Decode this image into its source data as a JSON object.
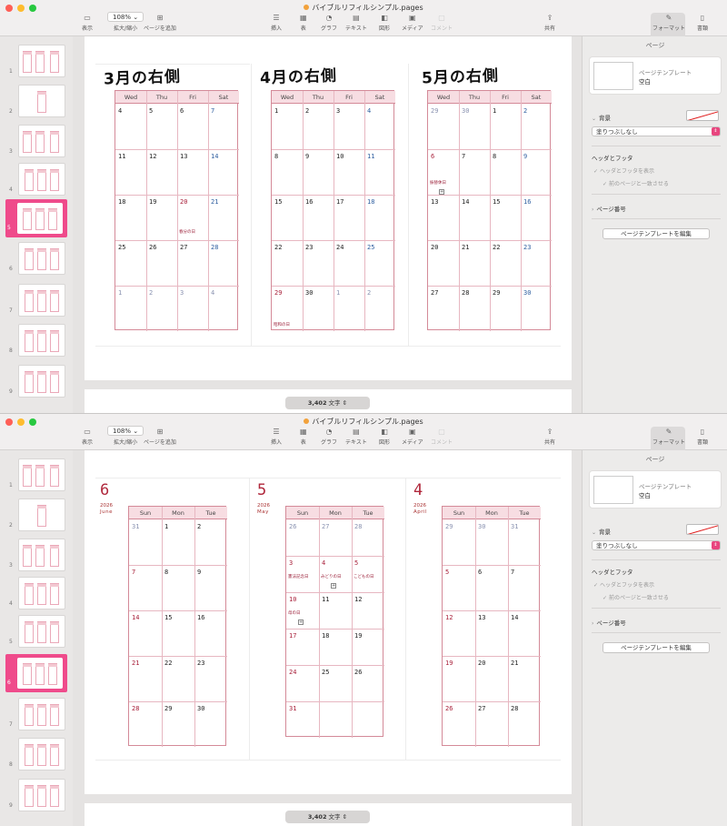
{
  "window": {
    "filename": "バイブルリフィルシンプル.pages"
  },
  "toolbar": {
    "view": "表示",
    "zoom_value": "108%",
    "zoom_label": "拡大/縮小",
    "add_page": "ページを追加",
    "insert": "挿入",
    "table": "表",
    "chart": "グラフ",
    "text": "テキスト",
    "shape": "図形",
    "media": "メディア",
    "comment": "コメント",
    "share": "共有",
    "format": "フォーマット",
    "document": "書類"
  },
  "colors": {
    "accent": "#ef4b8b",
    "calendar_border": "#d48a98",
    "calendar_header": "#f7dde2",
    "sunday_red": "#a8203a",
    "saturday_blue": "#2f5fa0"
  },
  "icons": {
    "view": "sidebar-icon",
    "zoom": "chevron-down-icon",
    "add_page": "plus-square-icon",
    "insert": "list-icon",
    "table": "table-icon",
    "chart": "clock-chart-icon",
    "text": "text-box-icon",
    "shape": "shape-icon",
    "media": "image-icon",
    "comment": "speech-bubble-icon",
    "share": "share-icon",
    "format": "paintbrush-icon",
    "document": "document-icon"
  },
  "wordcount": {
    "value": "3,402",
    "unit": "文字"
  },
  "inspector": {
    "title": "ページ",
    "tpl_label": "ページテンプレート",
    "tpl_name": "空白",
    "background": "背景",
    "fill": "塗りつぶしなし",
    "header_footer": "ヘッダとフッタ",
    "show_header_footer": "ヘッダとフッタを表示",
    "match_previous": "前のページと一致させる",
    "page_number": "ページ番号",
    "edit_template": "ページテンプレートを編集"
  },
  "sidebar": {
    "pages_top": [
      "1",
      "2",
      "3",
      "4",
      "5",
      "6",
      "7",
      "8",
      "9"
    ],
    "pages_bottom": [
      "1",
      "2",
      "3",
      "4",
      "5",
      "6",
      "7",
      "8",
      "9"
    ]
  },
  "top_page": {
    "calendars": [
      {
        "title": "3月の右側",
        "days": [
          "Wed",
          "Thu",
          "Fri",
          "Sat"
        ],
        "rows": [
          [
            "4",
            "5",
            "6",
            "7"
          ],
          [
            "11",
            "12",
            "13",
            "14"
          ],
          [
            "18",
            "19",
            "20",
            "21"
          ],
          [
            "25",
            "26",
            "27",
            "28"
          ],
          [
            "1",
            "2",
            "3",
            "4"
          ]
        ],
        "events": [
          {
            "row": 2,
            "col": 2,
            "text": "春分の日"
          }
        ]
      },
      {
        "title": "4月の右側",
        "days": [
          "Wed",
          "Thu",
          "Fri",
          "Sat"
        ],
        "rows": [
          [
            "1",
            "2",
            "3",
            "4"
          ],
          [
            "8",
            "9",
            "10",
            "11"
          ],
          [
            "15",
            "16",
            "17",
            "18"
          ],
          [
            "22",
            "23",
            "24",
            "25"
          ],
          [
            "29",
            "30",
            "1",
            "2"
          ]
        ],
        "events": [
          {
            "row": 4,
            "col": 0,
            "text": "昭和の日"
          }
        ]
      },
      {
        "title": "5月の右側",
        "days": [
          "Wed",
          "Thu",
          "Fri",
          "Sat"
        ],
        "rows": [
          [
            "29",
            "30",
            "1",
            "2"
          ],
          [
            "6",
            "7",
            "8",
            "9"
          ],
          [
            "13",
            "14",
            "15",
            "16"
          ],
          [
            "20",
            "21",
            "22",
            "23"
          ],
          [
            "27",
            "28",
            "29",
            "30"
          ]
        ],
        "events": [
          {
            "row": 1,
            "col": 0,
            "text": "振替休日"
          }
        ]
      }
    ]
  },
  "bottom_page": {
    "calendars": [
      {
        "month": "6",
        "year": "2026",
        "english": "June",
        "days": [
          "Sun",
          "Mon",
          "Tue"
        ],
        "rows": [
          [
            "31",
            "1",
            "2"
          ],
          [
            "7",
            "8",
            "9"
          ],
          [
            "14",
            "15",
            "16"
          ],
          [
            "21",
            "22",
            "23"
          ],
          [
            "28",
            "29",
            "30"
          ]
        ],
        "events": []
      },
      {
        "month": "5",
        "year": "2026",
        "english": "May",
        "days": [
          "Sun",
          "Mon",
          "Tue"
        ],
        "rows": [
          [
            "26",
            "27",
            "28"
          ],
          [
            "3",
            "4",
            "5"
          ],
          [
            "10",
            "11",
            "12"
          ],
          [
            "17",
            "18",
            "19"
          ],
          [
            "24",
            "25",
            "26"
          ],
          [
            "31",
            "",
            ""
          ]
        ],
        "events": [
          {
            "row": 1,
            "col": 0,
            "text": "憲法記念日"
          },
          {
            "row": 1,
            "col": 1,
            "text": "みどりの日"
          },
          {
            "row": 1,
            "col": 2,
            "text": "こどもの日"
          },
          {
            "row": 2,
            "col": 0,
            "text": "母の日"
          }
        ]
      },
      {
        "month": "4",
        "year": "2026",
        "english": "April",
        "days": [
          "Sun",
          "Mon",
          "Tue"
        ],
        "rows": [
          [
            "29",
            "30",
            "31"
          ],
          [
            "5",
            "6",
            "7"
          ],
          [
            "12",
            "13",
            "14"
          ],
          [
            "19",
            "20",
            "21"
          ],
          [
            "26",
            "27",
            "28"
          ]
        ],
        "events": []
      }
    ]
  }
}
